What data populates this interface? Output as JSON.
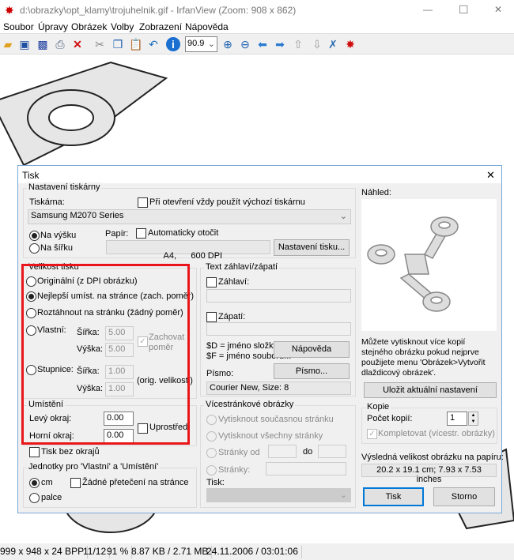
{
  "window": {
    "title": "d:\\obrazky\\opt_klamy\\trojuhelnik.gif - IrfanView (Zoom: 908 x 862)",
    "minimize": "—",
    "maximize": "☐",
    "close": "✕"
  },
  "menu": [
    "Soubor",
    "Úpravy",
    "Obrázek",
    "Volby",
    "Zobrazení",
    "Nápověda"
  ],
  "toolbar": {
    "zoom_value": "90.9",
    "icons": [
      "open-icon",
      "slideshow-icon",
      "save-icon",
      "print-icon",
      "delete-icon",
      "cut-icon",
      "copy-icon",
      "paste-icon",
      "undo-icon",
      "info-icon",
      "zoom-in-icon",
      "zoom-out-icon",
      "previous-icon",
      "next-icon",
      "first-page-icon",
      "last-page-icon",
      "settings-icon",
      "irfanview-logo-icon"
    ]
  },
  "dialog": {
    "title": "Tisk",
    "close": "✕",
    "printer": {
      "group": "Nastavení tiskárny",
      "printer_label": "Tiskárna:",
      "default_checkbox": "Při otevření vždy použít výchozí tiskárnu",
      "printer_value": "Samsung M2070 Series",
      "portrait": "Na výšku",
      "landscape": "Na šířku",
      "paper_label": "Papír:",
      "auto_rotate": "Automaticky otočit",
      "paper_value": "A4,      600 DPI",
      "setup_button": "Nastavení tisku..."
    },
    "size": {
      "group": "Velikost tisku",
      "original": "Originální (z DPI obrázku)",
      "best_fit": "Nejlepší umíst. na stránce (zach. poměr)",
      "stretch": "Roztáhnout na stránku (žádný poměr)",
      "custom": "Vlastní:",
      "width_label": "Šířka:",
      "height_label": "Výška:",
      "custom_width": "5.00",
      "custom_height": "5.00",
      "keep_ratio_1": "Zachovat",
      "keep_ratio_2": "poměr",
      "scale": "Stupnice:",
      "scale_width": "1.00",
      "scale_height": "1.00",
      "orig_size": "(orig. velikosti)",
      "selected": "best_fit"
    },
    "position": {
      "group": "Umístění",
      "left_label": "Levý okraj:",
      "left_value": "0.00",
      "top_label": "Horní okraj:",
      "top_value": "0.00",
      "center": "Uprostřed"
    },
    "borderless": "Tisk bez okrajů",
    "units": {
      "group": "Jednotky pro 'Vlastní' a 'Umístění'",
      "cm": "cm",
      "inch": "palce",
      "no_overflow": "Žádné přetečení na stránce",
      "selected": "cm"
    },
    "header_footer": {
      "group": "Text záhlaví/zápatí",
      "header": "Záhlaví:",
      "footer": "Zápatí:",
      "help_1": "$D = jméno složky,",
      "help_2": "$F = jméno souboru...",
      "help_button": "Nápověda",
      "font_label": "Písmo:",
      "font_button": "Písmo...",
      "font_value": "Courier New, Size: 8"
    },
    "multipage": {
      "group": "Vícestránkové obrázky",
      "current": "Vytisknout současnou stránku",
      "all": "Vytisknout všechny stránky",
      "from": "Stránky od",
      "to": "do",
      "pages": "Stránky:",
      "print_label": "Tisk:"
    },
    "preview_label": "Náhled:",
    "info": "Můžete vytisknout více kopií stejného obrázku pokud nejprve použijete menu 'Obrázek>Vytvořit dlaždicový obrázek'.",
    "save_button": "Uložit aktuální nastavení",
    "copies": {
      "group": "Kopie",
      "count_label": "Počet kopií:",
      "count_value": "1",
      "collate": "Kompletovat (vícestr. obrázky)"
    },
    "result_label": "Výsledná velikost obrázku na papíru:",
    "result_value": "20.2 x 19.1 cm; 7.93 x 7.53 inches",
    "print_button": "Tisk",
    "cancel_button": "Storno"
  },
  "status": [
    "999 x 948 x 24 BPP",
    "11/12",
    "91 %",
    "8.87 KB / 2.71 MB",
    "24.11.2006 / 03:01:06"
  ],
  "colors": {
    "highlight": "#e8161b",
    "accent": "#0078d7"
  }
}
